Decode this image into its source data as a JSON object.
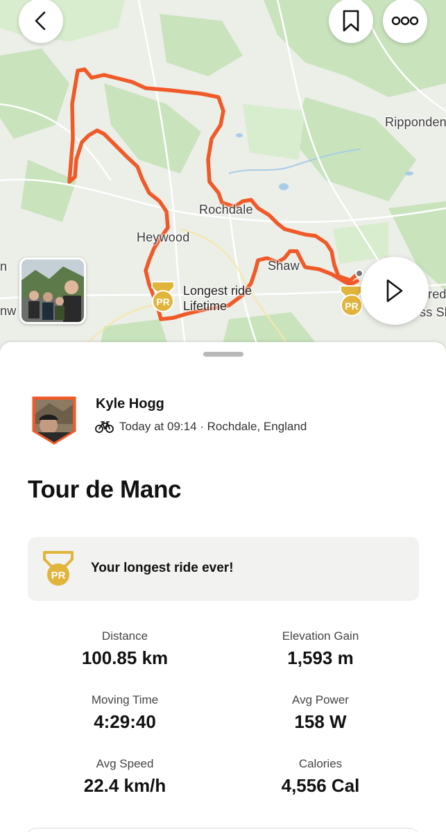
{
  "map": {
    "places": [
      "Ripponden",
      "Rochdale",
      "Heywood",
      "Shaw",
      "red",
      "ss Sl",
      "n",
      "nw"
    ],
    "pr_marker": {
      "badge": "PR",
      "label_line1": "Longest ride",
      "label_line2": "Lifetime"
    },
    "route_color": "#F05A28"
  },
  "top_bar": {
    "back_icon": "chevron-left-icon",
    "bookmark_icon": "bookmark-icon",
    "more_icon": "more-dots-icon"
  },
  "play_icon": "play-icon",
  "athlete": {
    "name": "Kyle Hogg",
    "meta": "Today at 09:14 · Rochdale, England",
    "sport_icon": "bike-icon"
  },
  "activity": {
    "title": "Tour de Manc"
  },
  "achievement": {
    "badge": "PR",
    "text": "Your longest ride ever!"
  },
  "stats": [
    {
      "label": "Distance",
      "value": "100.85 km"
    },
    {
      "label": "Elevation Gain",
      "value": "1,593 m"
    },
    {
      "label": "Moving Time",
      "value": "4:29:40"
    },
    {
      "label": "Avg Power",
      "value": "158 W"
    },
    {
      "label": "Avg Speed",
      "value": "22.4 km/h"
    },
    {
      "label": "Calories",
      "value": "4,556 Cal"
    }
  ],
  "colors": {
    "accent": "#F05A28",
    "pr_gold": "#E1B43C",
    "card_bg": "#F2F2F1"
  }
}
